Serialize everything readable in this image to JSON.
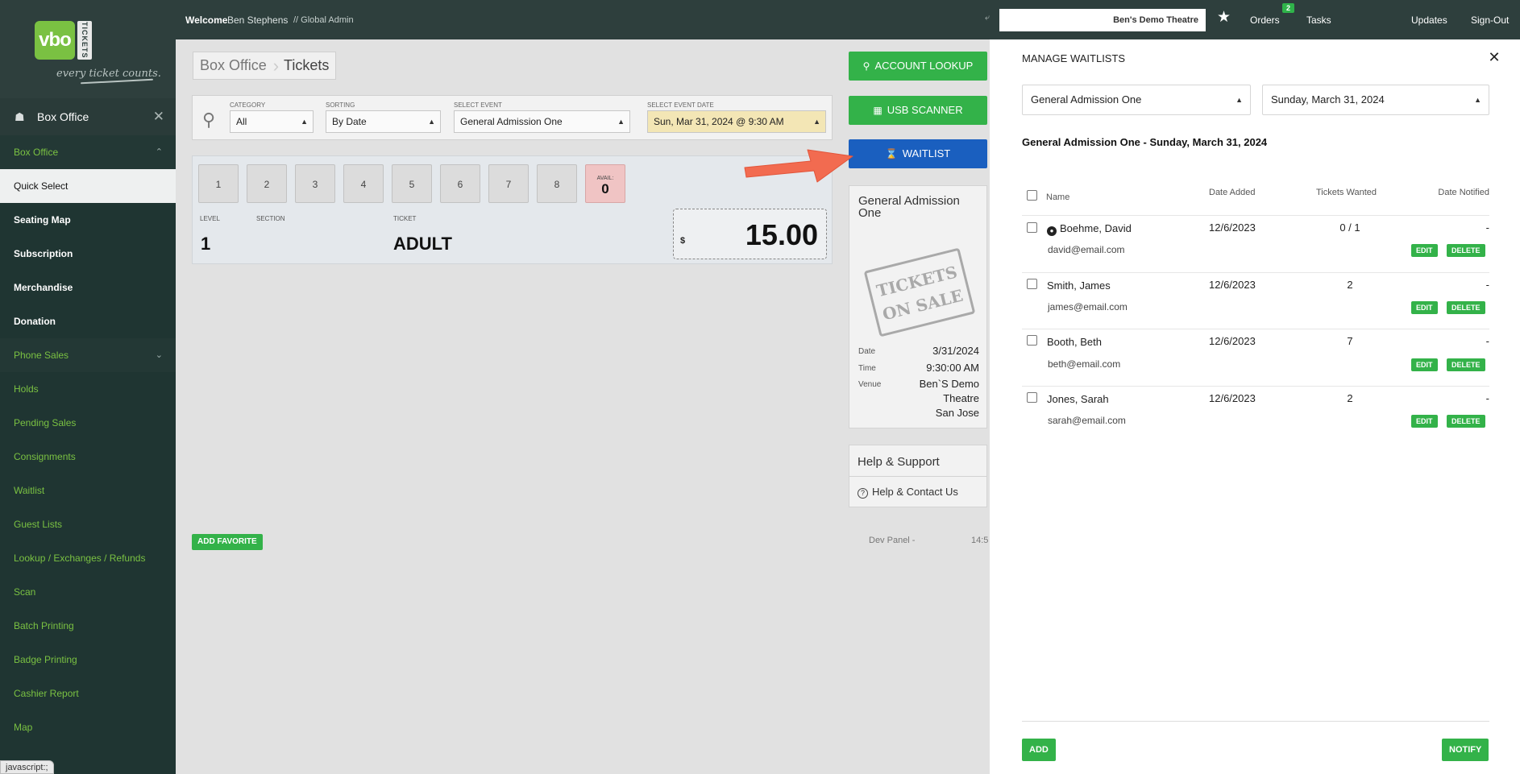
{
  "sidebar": {
    "logo_text": "vbo",
    "logo_side": "TICKETS",
    "tagline": "every ticket counts.",
    "header_title": "Box Office",
    "items": [
      {
        "label": "Box Office"
      },
      {
        "label": "Quick Select"
      },
      {
        "label": "Seating Map"
      },
      {
        "label": "Subscription"
      },
      {
        "label": "Merchandise"
      },
      {
        "label": "Donation"
      },
      {
        "label": "Phone Sales"
      },
      {
        "label": "Holds"
      },
      {
        "label": "Pending Sales"
      },
      {
        "label": "Consignments"
      },
      {
        "label": "Waitlist"
      },
      {
        "label": "Guest Lists"
      },
      {
        "label": "Lookup / Exchanges / Refunds"
      },
      {
        "label": "Scan"
      },
      {
        "label": "Batch Printing"
      },
      {
        "label": "Badge Printing"
      },
      {
        "label": "Cashier Report"
      },
      {
        "label": "Map"
      }
    ],
    "status_text": "javascript:;"
  },
  "topbar": {
    "welcome": "Welcome",
    "user": "Ben Stephens",
    "role": "// Global Admin",
    "theatre": "Ben's Demo Theatre",
    "orders": "Orders",
    "orders_badge": "2",
    "tasks": "Tasks",
    "updates": "Updates",
    "signout": "Sign-Out"
  },
  "breadcrumb": {
    "first": "Box Office",
    "second": "Tickets"
  },
  "filters": {
    "category_label": "CATEGORY",
    "category_value": "All",
    "sorting_label": "SORTING",
    "sorting_value": "By Date",
    "event_label": "SELECT EVENT",
    "event_value": "General Admission One",
    "date_label": "SELECT EVENT DATE",
    "date_value": "Sun, Mar 31, 2024 @ 9:30 AM"
  },
  "quantities": [
    "1",
    "2",
    "3",
    "4",
    "5",
    "6",
    "7",
    "8"
  ],
  "avail": {
    "label": "AVAIL:",
    "value": "0"
  },
  "ticket": {
    "level_label": "LEVEL",
    "section_label": "SECTION",
    "ticket_label": "TICKET",
    "level": "1",
    "section": "",
    "type": "ADULT",
    "currency": "$",
    "price": "15.00"
  },
  "add_favorite": "ADD FAVORITE",
  "dev_panel": "Dev Panel -",
  "clock_partial": "14:5",
  "actions": {
    "account_lookup": "ACCOUNT LOOKUP",
    "usb_scanner": "USB SCANNER",
    "waitlist": "WAITLIST"
  },
  "event_card": {
    "title": "General Admission One",
    "stamp_line1": "TICKETS",
    "stamp_line2": "ON SALE",
    "date_label": "Date",
    "date": "3/31/2024",
    "time_label": "Time",
    "time": "9:30:00 AM",
    "venue_label": "Venue",
    "venue_line1": "Ben`S Demo",
    "venue_line2": "Theatre",
    "venue_line3": "San Jose"
  },
  "help": {
    "title": "Help & Support",
    "link": "Help & Contact Us"
  },
  "waitlist_panel": {
    "title": "MANAGE WAITLISTS",
    "event_select": "General Admission One",
    "date_select": "Sunday, March 31, 2024",
    "heading": "General Admission One - Sunday, March 31, 2024",
    "columns": {
      "name": "Name",
      "date_added": "Date Added",
      "tickets_wanted": "Tickets Wanted",
      "date_notified": "Date Notified"
    },
    "rows": [
      {
        "name": "Boehme, David",
        "email": "david@email.com",
        "date_added": "12/6/2023",
        "tickets": "0 / 1",
        "notified": "-"
      },
      {
        "name": "Smith, James",
        "email": "james@email.com",
        "date_added": "12/6/2023",
        "tickets": "2",
        "notified": "-"
      },
      {
        "name": "Booth, Beth",
        "email": "beth@email.com",
        "date_added": "12/6/2023",
        "tickets": "7",
        "notified": "-"
      },
      {
        "name": "Jones, Sarah",
        "email": "sarah@email.com",
        "date_added": "12/6/2023",
        "tickets": "2",
        "notified": "-"
      }
    ],
    "edit": "EDIT",
    "delete": "DELETE",
    "add": "ADD",
    "notify": "NOTIFY"
  }
}
